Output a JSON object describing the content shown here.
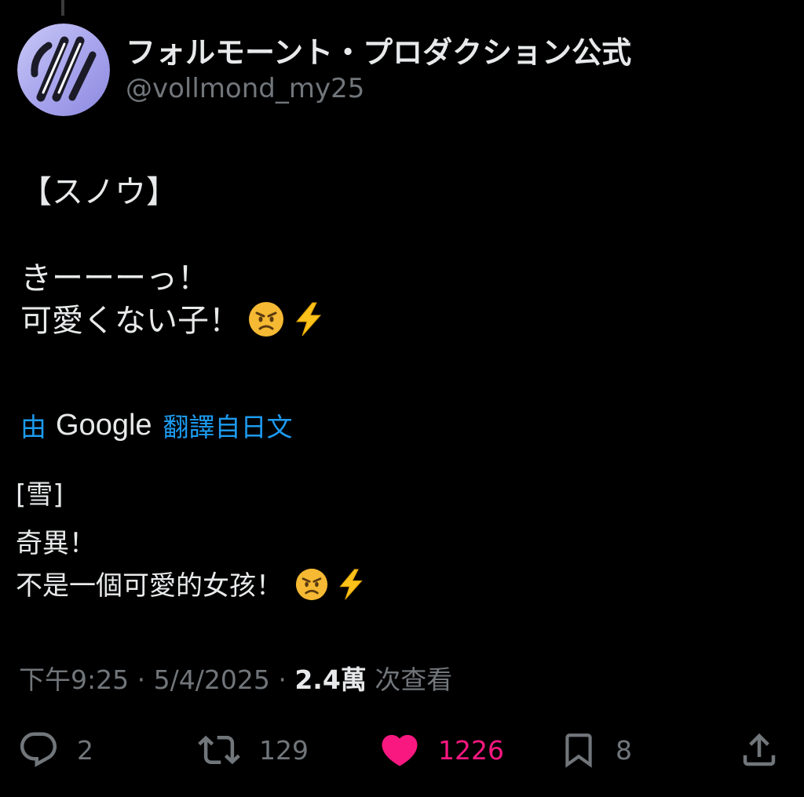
{
  "account": {
    "display_name": "フォルモーント・プロダクション公式",
    "handle": "@vollmond_my25"
  },
  "tweet": {
    "original_lines": [
      "【スノウ】",
      "きーーーっ！",
      "可愛くない子！"
    ],
    "original_emoji": [
      "angry-face",
      "high-voltage"
    ],
    "translation_prefix": "由",
    "translation_brand": "Google",
    "translation_suffix": "翻譯自日文",
    "translated_lines": [
      "[雪]",
      "奇異！",
      "不是一個可愛的女孩！"
    ],
    "translated_emoji": [
      "angry-face",
      "high-voltage"
    ]
  },
  "meta": {
    "time": "下午9:25",
    "separator": "·",
    "date": "5/4/2025",
    "views_count": "2.4萬",
    "views_label": "次查看"
  },
  "actions": {
    "replies": "2",
    "retweets": "129",
    "likes": "1226",
    "bookmarks": "8"
  },
  "colors": {
    "background": "#000000",
    "text": "#e7e9ea",
    "secondary": "#71767b",
    "link": "#1d9bf0",
    "like": "#f91880"
  }
}
